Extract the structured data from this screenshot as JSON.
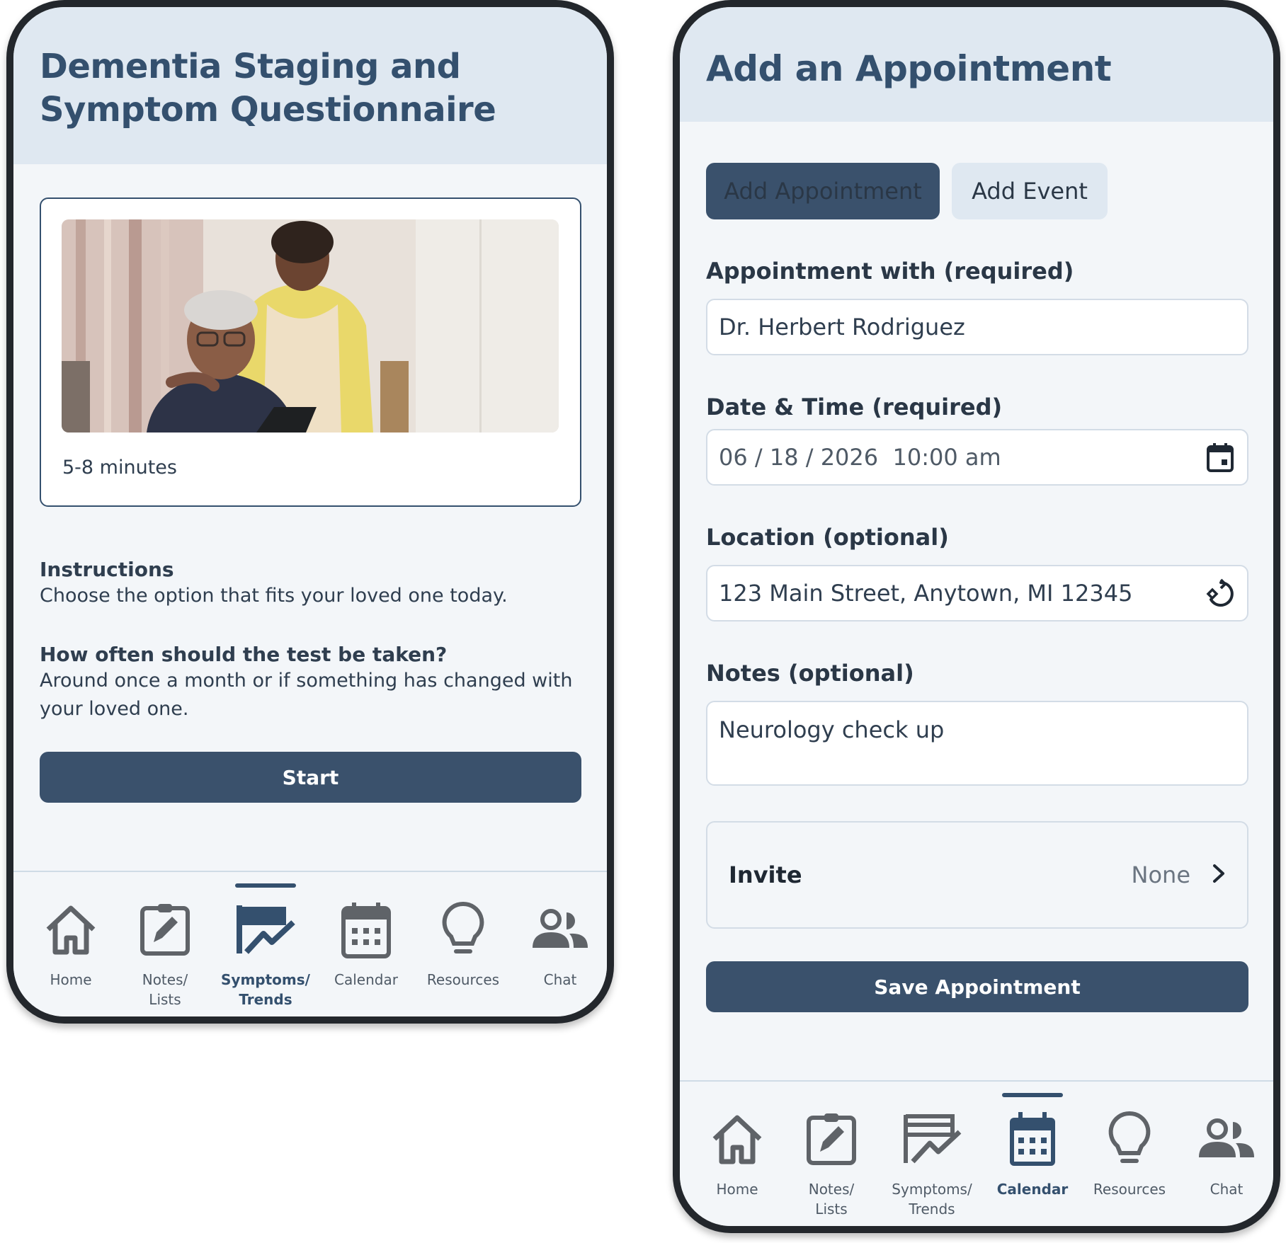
{
  "left_screen": {
    "title": "Dementia Staging and Symptom Questionnaire",
    "card": {
      "image_alt": "Caregiver standing behind an older man seated with a tablet",
      "duration": "5-8 minutes"
    },
    "instructions": {
      "heading": "Instructions",
      "text": "Choose the option that fits your loved one today."
    },
    "frequency": {
      "heading": "How often should the test be taken?",
      "text": "Around once a month or if something has changed with your loved one."
    },
    "start_label": "Start",
    "active_tab": "Symptoms/ Trends"
  },
  "right_screen": {
    "title": "Add an Appointment",
    "segments": [
      {
        "label": "Add Appointment",
        "selected": true
      },
      {
        "label": "Add Event",
        "selected": false
      }
    ],
    "fields": {
      "appointment_with": {
        "label": "Appointment with (required)",
        "value": "Dr. Herbert Rodriguez"
      },
      "date_time": {
        "label": "Date & Time (required)",
        "value": "06 / 18 / 2026  10:00 am",
        "icon": "calendar-icon"
      },
      "location": {
        "label": "Location (optional)",
        "value": "123 Main Street, Anytown, MI 12345",
        "icon": "location-arrow-icon"
      },
      "notes": {
        "label": "Notes (optional)",
        "value": "Neurology check up"
      }
    },
    "invite": {
      "label": "Invite",
      "value": "None"
    },
    "save_label": "Save Appointment",
    "active_tab": "Calendar"
  },
  "nav": {
    "items": [
      {
        "label": "Home",
        "icon": "home-icon"
      },
      {
        "label": "Notes/\nLists",
        "icon": "notes-icon"
      },
      {
        "label": "Symptoms/\nTrends",
        "icon": "trends-icon"
      },
      {
        "label": "Calendar",
        "icon": "calendar-icon"
      },
      {
        "label": "Resources",
        "icon": "lightbulb-icon"
      },
      {
        "label": "Chat",
        "icon": "people-icon"
      }
    ]
  },
  "colors": {
    "primary": "#3a516c",
    "title": "#34506e",
    "header_bg": "#dfe8f1",
    "screen_bg": "#f3f6f9",
    "bezel": "#23272c",
    "nav_icon": "#5f6368"
  }
}
